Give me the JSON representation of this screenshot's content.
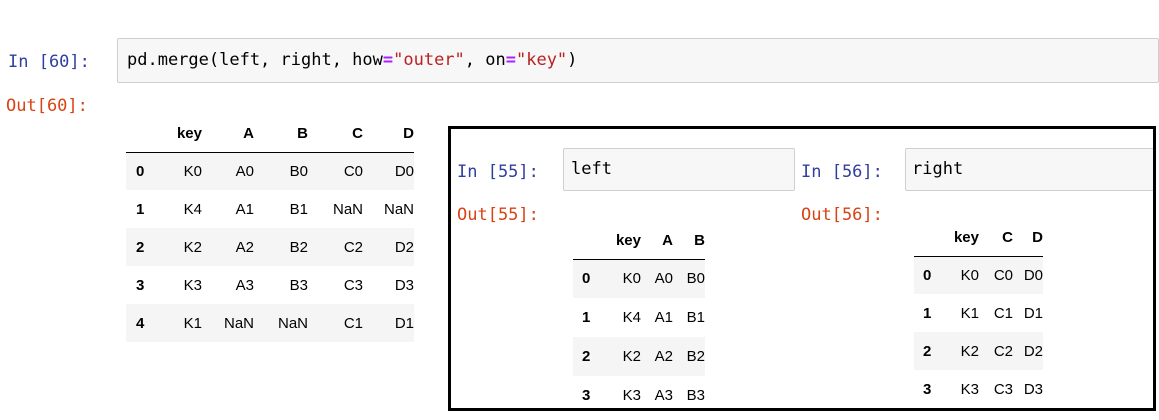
{
  "main_cell": {
    "in_prompt": "In [60]:",
    "out_prompt": "Out[60]:",
    "code": {
      "fn": "pd.merge(left, right, how",
      "eq1": "=",
      "how_value": "\"outer\"",
      "mid": ", on",
      "eq2": "=",
      "on_value": "\"key\"",
      "close": ")"
    },
    "table": {
      "columns": [
        "key",
        "A",
        "B",
        "C",
        "D"
      ],
      "rows": [
        {
          "index": "0",
          "values": [
            "K0",
            "A0",
            "B0",
            "C0",
            "D0"
          ]
        },
        {
          "index": "1",
          "values": [
            "K4",
            "A1",
            "B1",
            "NaN",
            "NaN"
          ]
        },
        {
          "index": "2",
          "values": [
            "K2",
            "A2",
            "B2",
            "C2",
            "D2"
          ]
        },
        {
          "index": "3",
          "values": [
            "K3",
            "A3",
            "B3",
            "C3",
            "D3"
          ]
        },
        {
          "index": "4",
          "values": [
            "K1",
            "NaN",
            "NaN",
            "C1",
            "D1"
          ]
        }
      ]
    }
  },
  "left_cell": {
    "in_prompt": "In [55]:",
    "out_prompt": "Out[55]:",
    "code": "left",
    "table": {
      "columns": [
        "key",
        "A",
        "B"
      ],
      "rows": [
        {
          "index": "0",
          "values": [
            "K0",
            "A0",
            "B0"
          ]
        },
        {
          "index": "1",
          "values": [
            "K4",
            "A1",
            "B1"
          ]
        },
        {
          "index": "2",
          "values": [
            "K2",
            "A2",
            "B2"
          ]
        },
        {
          "index": "3",
          "values": [
            "K3",
            "A3",
            "B3"
          ]
        }
      ]
    }
  },
  "right_cell": {
    "in_prompt": "In [56]:",
    "out_prompt": "Out[56]:",
    "code": "right",
    "table": {
      "columns": [
        "key",
        "C",
        "D"
      ],
      "rows": [
        {
          "index": "0",
          "values": [
            "K0",
            "C0",
            "D0"
          ]
        },
        {
          "index": "1",
          "values": [
            "K1",
            "C1",
            "D1"
          ]
        },
        {
          "index": "2",
          "values": [
            "K2",
            "C2",
            "D2"
          ]
        },
        {
          "index": "3",
          "values": [
            "K3",
            "C3",
            "D3"
          ]
        }
      ]
    }
  },
  "colors": {
    "in_prompt": "#303f9f",
    "out_prompt": "#d84315",
    "string": "#ba2121",
    "operator": "#aa22ff"
  }
}
